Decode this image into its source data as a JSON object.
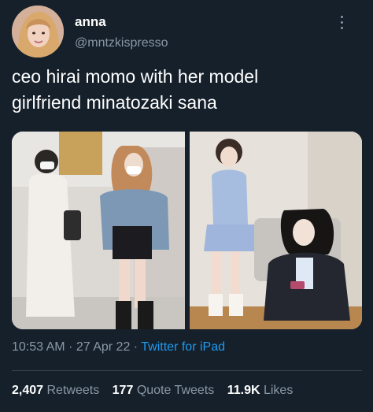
{
  "tweet": {
    "author": {
      "display_name": "anna",
      "handle": "@mntzkispresso"
    },
    "text_line1": "ceo hirai momo with her model",
    "text_line2": "girlfriend minatozaki sana",
    "meta": {
      "time": "10:53 AM",
      "date": "27 Apr 22",
      "separator": "·",
      "source": "Twitter for iPad"
    },
    "stats": [
      {
        "count": "2,407",
        "label": "Retweets"
      },
      {
        "count": "177",
        "label": "Quote Tweets"
      },
      {
        "count": "11.9K",
        "label": "Likes"
      }
    ]
  },
  "colors": {
    "background": "#15202b",
    "text": "#ffffff",
    "secondary_text": "#8b98a5",
    "link": "#1d9bf0",
    "divider": "#38444d"
  },
  "icons": [
    "more-options-icon"
  ]
}
